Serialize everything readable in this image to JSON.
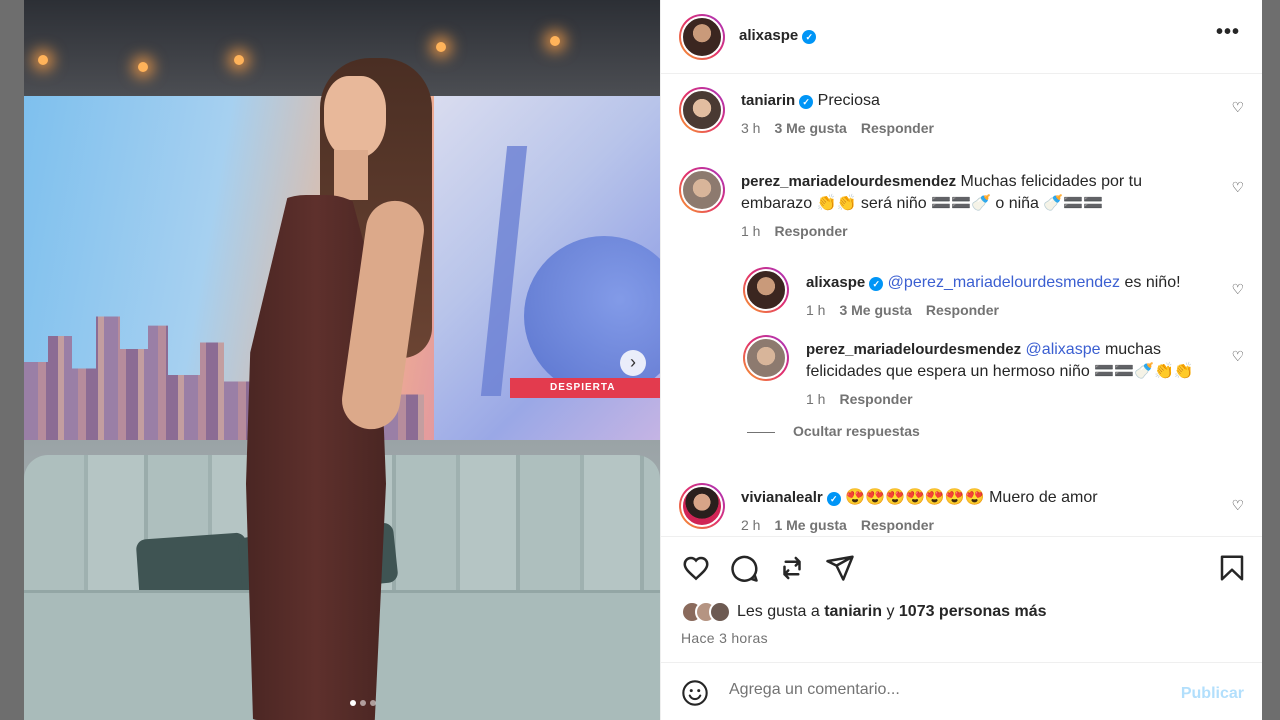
{
  "post": {
    "author": "alixaspe",
    "author_verified": true,
    "more_label": "•••",
    "carousel_next": "›"
  },
  "photo": {
    "lower_third_text": "DESPIERTA",
    "slides_total": 3,
    "current_slide": 1
  },
  "comments": [
    {
      "user": "taniarin",
      "verified": true,
      "text": "Preciosa",
      "time": "3 h",
      "likes": "3 Me gusta",
      "reply": "Responder"
    },
    {
      "user": "perez_mariadelourdesmendez",
      "verified": false,
      "text": "Muchas felicidades por tu embarazo 👏👏 será niño 🟰🟰🍼 o niña 🍼🟰🟰",
      "time": "1 h",
      "reply": "Responder"
    },
    {
      "user": "alixaspe",
      "verified": true,
      "mention": "@perez_mariadelourdesmendez",
      "text": "es niño!",
      "time": "1 h",
      "likes": "3 Me gusta",
      "reply": "Responder"
    },
    {
      "user": "perez_mariadelourdesmendez",
      "verified": false,
      "mention": "@alixaspe",
      "text": "muchas felicidades que espera un hermoso niño 🟰🟰🍼👏👏",
      "time": "1 h",
      "reply": "Responder"
    },
    {
      "user": "vivianalealr",
      "verified": true,
      "text": "😍😍😍😍😍😍😍 Muero de amor",
      "time": "2 h",
      "likes": "1 Me gusta",
      "reply": "Responder"
    }
  ],
  "hide_replies_label": "Ocultar respuestas",
  "likes_summary": {
    "prefix": "Les gusta a",
    "user": "taniarin",
    "joiner": "y",
    "others": "1073 personas más"
  },
  "posted_ago": "Hace 3 horas",
  "composer": {
    "placeholder": "Agrega un comentario...",
    "publish_label": "Publicar"
  },
  "colors": {
    "link": "#3b5fd1",
    "verified": "#0095f6",
    "publish_disabled": "#b2dffc",
    "muted": "#737373"
  },
  "icons": [
    "heart-icon",
    "comment-icon",
    "repost-icon",
    "share-icon",
    "bookmark-icon",
    "emoji-icon",
    "more-icon",
    "verified-icon"
  ]
}
